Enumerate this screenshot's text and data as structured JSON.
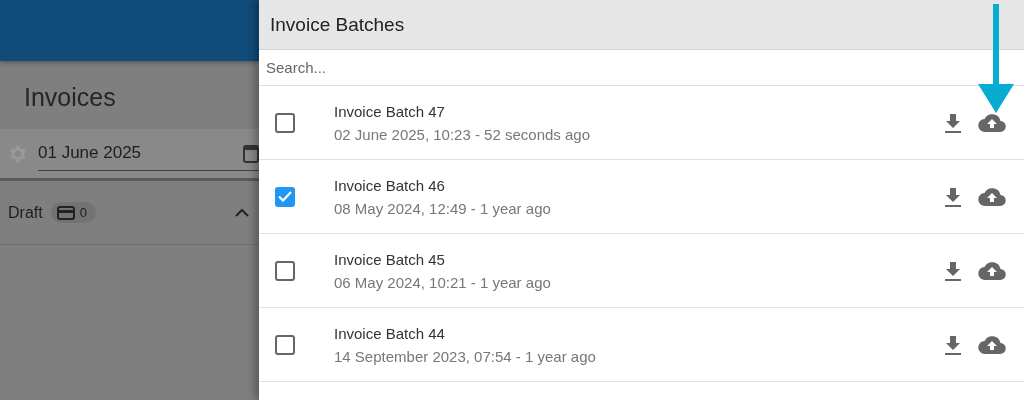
{
  "page": {
    "title": "Invoices",
    "date_field": {
      "value": "01 June 2025"
    },
    "sections": [
      {
        "label": "Draft",
        "count": "0",
        "expanded": true
      }
    ]
  },
  "drawer": {
    "title": "Invoice Batches",
    "search": {
      "placeholder": "Search..."
    },
    "batches": [
      {
        "name": "Invoice Batch 47",
        "date": "02 June 2025, 10:23 - 52 seconds ago",
        "selected": false
      },
      {
        "name": "Invoice Batch 46",
        "date": "08 May 2024, 12:49 - 1 year ago",
        "selected": true
      },
      {
        "name": "Invoice Batch 45",
        "date": "06 May 2024, 10:21 - 1 year ago",
        "selected": false
      },
      {
        "name": "Invoice Batch 44",
        "date": "14 September 2023, 07:54 - 1 year ago",
        "selected": false
      }
    ]
  }
}
